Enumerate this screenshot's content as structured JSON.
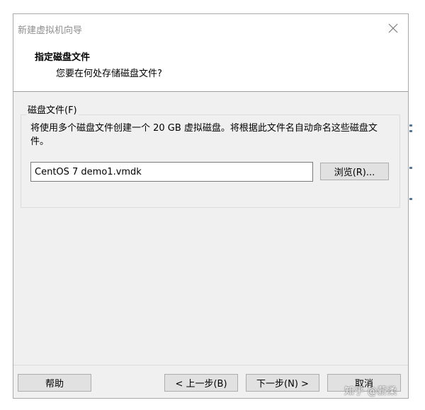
{
  "window": {
    "title": "新建虚拟机向导",
    "close_icon": "close-icon"
  },
  "header": {
    "title": "指定磁盘文件",
    "subtitle": "您要在何处存储磁盘文件?"
  },
  "disk_file_group": {
    "label": "磁盘文件(F)",
    "description": "将使用多个磁盘文件创建一个 20 GB 虚拟磁盘。将根据此文件名自动命名这些磁盘文件。",
    "file_name_value": "CentOS 7 demo1.vmdk",
    "browse_label": "浏览(R)..."
  },
  "footer": {
    "help_label": "帮助",
    "back_label": "< 上一步(B)",
    "next_label": "下一步(N) >",
    "cancel_label": "取消"
  },
  "watermark": {
    "text": "知乎 @薪柔"
  },
  "colors": {
    "dialog_bg": "#f0f0f0",
    "header_bg": "#ffffff",
    "button_bg": "#e1e1e1",
    "title_text": "#8f8f8f"
  }
}
